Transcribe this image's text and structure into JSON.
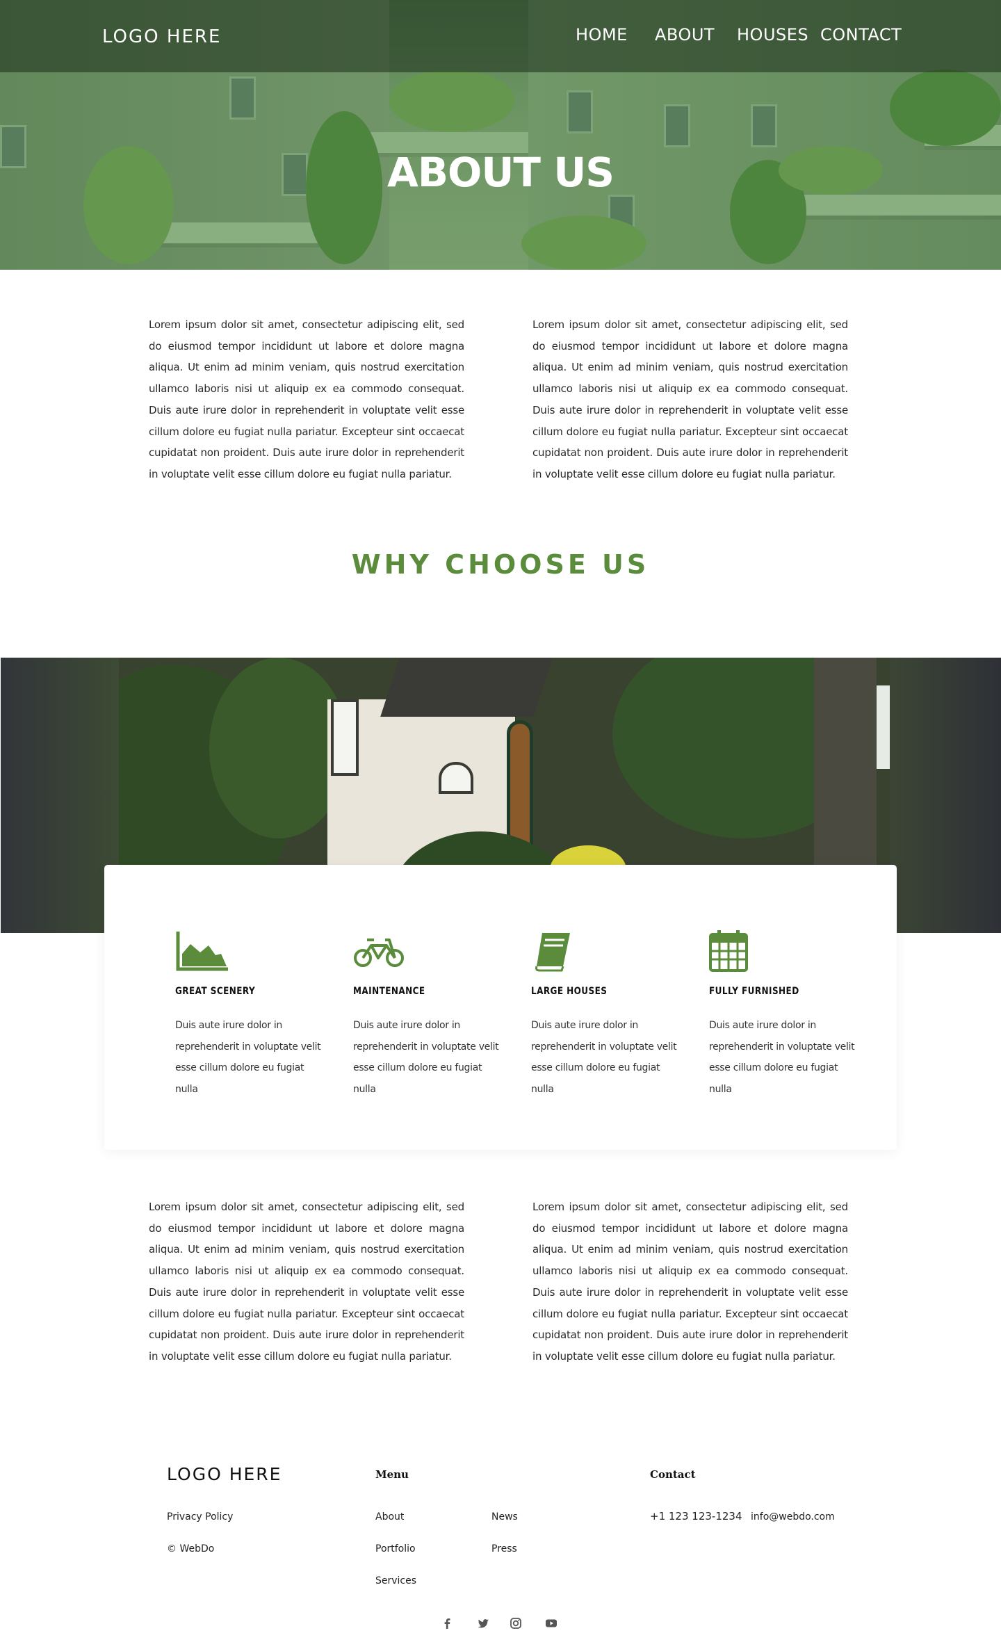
{
  "header": {
    "logo": "LOGO HERE",
    "nav": [
      "HOME",
      "ABOUT",
      "HOUSES",
      "CONTACT"
    ],
    "hero_title": "ABOUT US"
  },
  "intro": {
    "left": "Lorem ipsum dolor sit amet, consectetur adipiscing elit, sed do eiusmod tempor incididunt ut labore et dolore magna aliqua. Ut enim ad minim veniam, quis nostrud exercitation ullamco laboris nisi ut aliquip ex ea commodo consequat. Duis aute irure dolor in reprehenderit in voluptate velit esse cillum dolore eu fugiat nulla pariatur. Excepteur sint occaecat cupidatat non proident. Duis aute irure dolor in reprehenderit in voluptate velit esse cillum dolore eu fugiat nulla pariatur.",
    "right": "Lorem ipsum dolor sit amet, consectetur adipiscing elit, sed do eiusmod tempor incididunt ut labore et dolore magna aliqua. Ut enim ad minim veniam, quis nostrud exercitation ullamco laboris nisi ut aliquip ex ea commodo consequat. Duis aute irure dolor in reprehenderit in voluptate velit esse cillum dolore eu fugiat nulla pariatur. Excepteur sint occaecat cupidatat non proident. Duis aute irure dolor in reprehenderit in voluptate velit esse cillum dolore eu fugiat nulla pariatur."
  },
  "why_title": "WHY CHOOSE US",
  "features": [
    {
      "icon": "area-chart-icon",
      "title": "GREAT SCENERY",
      "text": "Duis aute irure dolor in reprehenderit in voluptate velit esse cillum dolore eu fugiat nulla"
    },
    {
      "icon": "bicycle-icon",
      "title": "MAINTENANCE",
      "text": "Duis aute irure dolor in reprehenderit in voluptate velit esse cillum dolore eu fugiat nulla"
    },
    {
      "icon": "book-icon",
      "title": "LARGE HOUSES",
      "text": "Duis aute irure dolor in reprehenderit in voluptate velit esse cillum dolore eu fugiat nulla"
    },
    {
      "icon": "calendar-icon",
      "title": "FULLY FURNISHED",
      "text": "Duis aute irure dolor in reprehenderit in voluptate velit esse cillum dolore eu fugiat nulla"
    }
  ],
  "outro": {
    "left": "Lorem ipsum dolor sit amet, consectetur adipiscing elit, sed do eiusmod tempor incididunt ut labore et dolore magna aliqua. Ut enim ad minim veniam, quis nostrud exercitation ullamco laboris nisi ut aliquip ex ea commodo consequat. Duis aute irure dolor in reprehenderit in voluptate velit esse cillum dolore eu fugiat nulla pariatur. Excepteur sint occaecat cupidatat non proident. Duis aute irure dolor in reprehenderit in voluptate velit esse cillum dolore eu fugiat nulla pariatur.",
    "right": "Lorem ipsum dolor sit amet, consectetur adipiscing elit, sed do eiusmod tempor incididunt ut labore et dolore magna aliqua. Ut enim ad minim veniam, quis nostrud exercitation ullamco laboris nisi ut aliquip ex ea commodo consequat. Duis aute irure dolor in reprehenderit in voluptate velit esse cillum dolore eu fugiat nulla pariatur. Excepteur sint occaecat cupidatat non proident. Duis aute irure dolor in reprehenderit in voluptate velit esse cillum dolore eu fugiat nulla pariatur."
  },
  "footer": {
    "logo": "LOGO HERE",
    "privacy": "Privacy Policy",
    "copyright": "© WebDo",
    "menu_heading": "Menu",
    "menu_col1": [
      "About",
      "Portfolio",
      "Services"
    ],
    "menu_col2": [
      "News",
      "Press"
    ],
    "contact_heading": "Contact",
    "phone": "+1 123 123-1234",
    "email": "info@webdo.com",
    "social": [
      "facebook-icon",
      "twitter-icon",
      "instagram-icon",
      "youtube-icon"
    ]
  },
  "colors": {
    "accent": "#5a8c3c",
    "nav_overlay": "#1c2d1a",
    "text": "#2a2a2a",
    "footer_icon": "#555555"
  }
}
